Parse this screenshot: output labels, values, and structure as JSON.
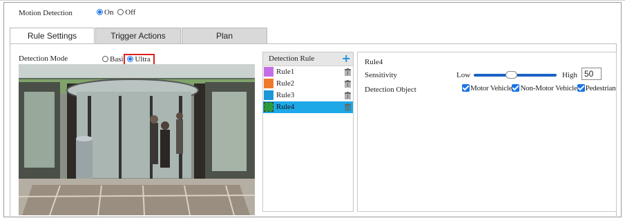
{
  "motion_detection": {
    "label": "Motion Detection",
    "options": [
      {
        "label": "On",
        "selected": true
      },
      {
        "label": "Off",
        "selected": false
      }
    ]
  },
  "tabs": [
    {
      "label": "Rule Settings",
      "active": true
    },
    {
      "label": "Trigger Actions",
      "active": false
    },
    {
      "label": "Plan",
      "active": false
    }
  ],
  "detection_mode": {
    "label": "Detection Mode",
    "options": [
      {
        "label": "Basic",
        "selected": false
      },
      {
        "label": "Ultra",
        "selected": true
      }
    ],
    "basic_visible_text": "Basi"
  },
  "rule_list": {
    "header": "Detection Rule",
    "add_icon": "plus-icon",
    "delete_icon": "trash-icon",
    "rules": [
      {
        "label": "Rule1",
        "color": "#c46ee8",
        "selected": false
      },
      {
        "label": "Rule2",
        "color": "#f07a2c",
        "selected": false
      },
      {
        "label": "Rule3",
        "color": "#1e96d8",
        "selected": false
      },
      {
        "label": "Rule4",
        "color": "#2d9b3c",
        "selected": true
      }
    ]
  },
  "rule_detail": {
    "title": "Rule4",
    "sensitivity_label": "Sensitivity",
    "low_label": "Low",
    "high_label": "High",
    "sensitivity_value": "50",
    "sensitivity_fraction": 0.5,
    "detection_object_label": "Detection Object",
    "objects": [
      {
        "label": "Motor Vehicle",
        "checked": true
      },
      {
        "label": "Non-Motor Vehicle",
        "checked": true
      },
      {
        "label": "Pedestrian",
        "checked": true
      }
    ]
  },
  "colors": {
    "accent": "#1a73e8",
    "selected_row": "#1ea8e8",
    "highlight_box": "#e02020"
  }
}
